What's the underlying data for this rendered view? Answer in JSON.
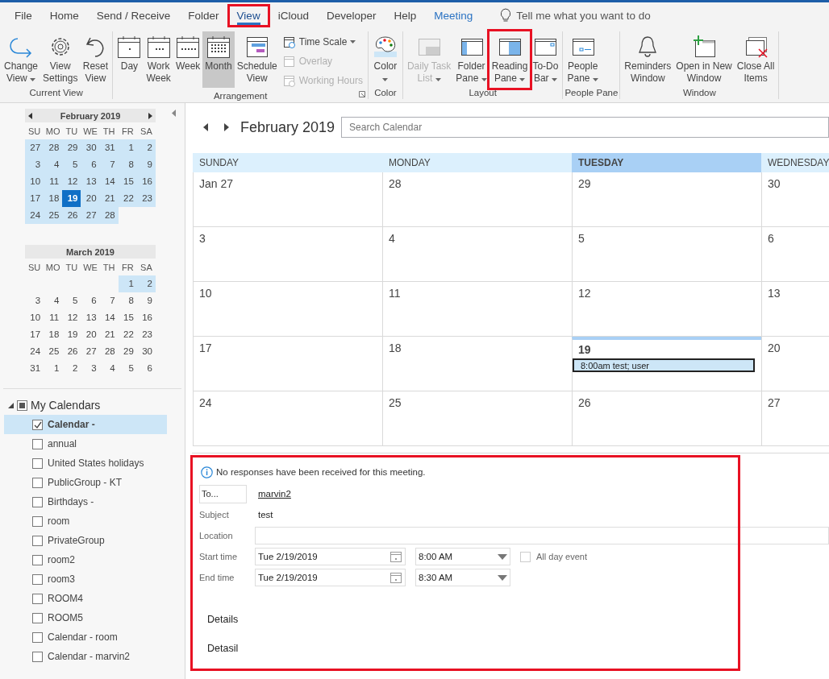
{
  "ribbon_tabs": [
    {
      "label": "File",
      "selected": false,
      "highlighted": false,
      "kind": "normal"
    },
    {
      "label": "Home",
      "selected": false,
      "highlighted": false,
      "kind": "normal"
    },
    {
      "label": "Send / Receive",
      "selected": false,
      "highlighted": false,
      "kind": "normal"
    },
    {
      "label": "Folder",
      "selected": false,
      "highlighted": false,
      "kind": "normal"
    },
    {
      "label": "View",
      "selected": true,
      "highlighted": true,
      "kind": "normal"
    },
    {
      "label": "iCloud",
      "selected": false,
      "highlighted": false,
      "kind": "normal"
    },
    {
      "label": "Developer",
      "selected": false,
      "highlighted": false,
      "kind": "normal"
    },
    {
      "label": "Help",
      "selected": false,
      "highlighted": false,
      "kind": "normal"
    },
    {
      "label": "Meeting",
      "selected": false,
      "highlighted": false,
      "kind": "contextual"
    }
  ],
  "tell_me": {
    "placeholder": "Tell me what you want to do"
  },
  "ribbon_groups": [
    {
      "label": "Current View",
      "buttons": [
        {
          "label": "Change View",
          "dropdown": true,
          "disabled": false,
          "selected": false,
          "highlighted": false
        },
        {
          "label": "View Settings",
          "dropdown": false,
          "disabled": false,
          "selected": false,
          "highlighted": false
        },
        {
          "label": "Reset View",
          "dropdown": false,
          "disabled": false,
          "selected": false,
          "highlighted": false
        }
      ]
    },
    {
      "label": "Arrangement",
      "launcher": true,
      "buttons": [
        {
          "label": "Day",
          "dropdown": false,
          "disabled": false,
          "selected": false,
          "highlighted": false
        },
        {
          "label": "Work Week",
          "dropdown": false,
          "disabled": false,
          "selected": false,
          "highlighted": false
        },
        {
          "label": "Week",
          "dropdown": false,
          "disabled": false,
          "selected": false,
          "highlighted": false
        },
        {
          "label": "Month",
          "dropdown": false,
          "disabled": false,
          "selected": true,
          "highlighted": false
        },
        {
          "label": "Schedule View",
          "dropdown": false,
          "disabled": false,
          "selected": false,
          "highlighted": false
        }
      ],
      "small_buttons": [
        {
          "label": "Time Scale",
          "dropdown": true,
          "disabled": false
        },
        {
          "label": "Overlay",
          "dropdown": false,
          "disabled": true
        },
        {
          "label": "Working Hours",
          "dropdown": false,
          "disabled": true
        }
      ]
    },
    {
      "label": "Color",
      "buttons": [
        {
          "label": "Color",
          "dropdown": true,
          "disabled": false,
          "selected": false,
          "highlighted": false
        }
      ]
    },
    {
      "label": "Layout",
      "buttons": [
        {
          "label": "Daily Task List",
          "dropdown": true,
          "disabled": true,
          "selected": false,
          "highlighted": false
        },
        {
          "label": "Folder Pane",
          "dropdown": true,
          "disabled": false,
          "selected": false,
          "highlighted": false
        },
        {
          "label": "Reading Pane",
          "dropdown": true,
          "disabled": false,
          "selected": false,
          "highlighted": true
        },
        {
          "label": "To-Do Bar",
          "dropdown": true,
          "disabled": false,
          "selected": false,
          "highlighted": false
        }
      ]
    },
    {
      "label": "People Pane",
      "buttons": [
        {
          "label": "People Pane",
          "dropdown": true,
          "disabled": false,
          "selected": false,
          "highlighted": false
        }
      ]
    },
    {
      "label": "Window",
      "buttons": [
        {
          "label": "Reminders Window",
          "dropdown": false,
          "disabled": false,
          "selected": false,
          "highlighted": false
        },
        {
          "label": "Open in New Window",
          "dropdown": false,
          "disabled": false,
          "selected": false,
          "highlighted": false
        },
        {
          "label": "Close All Items",
          "dropdown": false,
          "disabled": false,
          "selected": false,
          "highlighted": false
        }
      ]
    }
  ],
  "mini_calendars": [
    {
      "title": "February 2019",
      "nav": true,
      "weekdays": [
        "SU",
        "MO",
        "TU",
        "WE",
        "TH",
        "FR",
        "SA"
      ],
      "weeks": [
        {
          "in_view": true,
          "days": [
            {
              "day": "27",
              "selected": false
            },
            {
              "day": "28",
              "selected": false
            },
            {
              "day": "29",
              "selected": false
            },
            {
              "day": "30",
              "selected": false
            },
            {
              "day": "31",
              "selected": false
            },
            {
              "day": "1",
              "selected": false
            },
            {
              "day": "2",
              "selected": false
            }
          ]
        },
        {
          "in_view": true,
          "days": [
            {
              "day": "3",
              "selected": false
            },
            {
              "day": "4",
              "selected": false
            },
            {
              "day": "5",
              "selected": false
            },
            {
              "day": "6",
              "selected": false
            },
            {
              "day": "7",
              "selected": false
            },
            {
              "day": "8",
              "selected": false
            },
            {
              "day": "9",
              "selected": false
            }
          ]
        },
        {
          "in_view": true,
          "days": [
            {
              "day": "10",
              "selected": false
            },
            {
              "day": "11",
              "selected": false
            },
            {
              "day": "12",
              "selected": false
            },
            {
              "day": "13",
              "selected": false
            },
            {
              "day": "14",
              "selected": false
            },
            {
              "day": "15",
              "selected": false
            },
            {
              "day": "16",
              "selected": false
            }
          ]
        },
        {
          "in_view": true,
          "days": [
            {
              "day": "17",
              "selected": false
            },
            {
              "day": "18",
              "selected": false
            },
            {
              "day": "19",
              "selected": true
            },
            {
              "day": "20",
              "selected": false
            },
            {
              "day": "21",
              "selected": false
            },
            {
              "day": "22",
              "selected": false
            },
            {
              "day": "23",
              "selected": false
            }
          ]
        },
        {
          "in_view": true,
          "days": [
            {
              "day": "24",
              "selected": false
            },
            {
              "day": "25",
              "selected": false
            },
            {
              "day": "26",
              "selected": false
            },
            {
              "day": "27",
              "selected": false
            },
            {
              "day": "28",
              "selected": false
            }
          ]
        }
      ]
    },
    {
      "title": "March 2019",
      "nav": false,
      "weekdays": [
        "SU",
        "MO",
        "TU",
        "WE",
        "TH",
        "FR",
        "SA"
      ],
      "weeks": [
        {
          "in_view": true,
          "days": [
            {
              "day": "1",
              "selected": false
            },
            {
              "day": "2",
              "selected": false
            }
          ]
        },
        {
          "in_view": false,
          "days": [
            {
              "day": "3",
              "selected": false
            },
            {
              "day": "4",
              "selected": false
            },
            {
              "day": "5",
              "selected": false
            },
            {
              "day": "6",
              "selected": false
            },
            {
              "day": "7",
              "selected": false
            },
            {
              "day": "8",
              "selected": false
            },
            {
              "day": "9",
              "selected": false
            }
          ]
        },
        {
          "in_view": false,
          "days": [
            {
              "day": "10",
              "selected": false
            },
            {
              "day": "11",
              "selected": false
            },
            {
              "day": "12",
              "selected": false
            },
            {
              "day": "13",
              "selected": false
            },
            {
              "day": "14",
              "selected": false
            },
            {
              "day": "15",
              "selected": false
            },
            {
              "day": "16",
              "selected": false
            }
          ]
        },
        {
          "in_view": false,
          "days": [
            {
              "day": "17",
              "selected": false
            },
            {
              "day": "18",
              "selected": false
            },
            {
              "day": "19",
              "selected": false
            },
            {
              "day": "20",
              "selected": false
            },
            {
              "day": "21",
              "selected": false
            },
            {
              "day": "22",
              "selected": false
            },
            {
              "day": "23",
              "selected": false
            }
          ]
        },
        {
          "in_view": false,
          "days": [
            {
              "day": "24",
              "selected": false
            },
            {
              "day": "25",
              "selected": false
            },
            {
              "day": "26",
              "selected": false
            },
            {
              "day": "27",
              "selected": false
            },
            {
              "day": "28",
              "selected": false
            },
            {
              "day": "29",
              "selected": false
            },
            {
              "day": "30",
              "selected": false
            }
          ]
        },
        {
          "in_view": false,
          "days": [
            {
              "day": "31",
              "selected": false
            },
            {
              "day": "1",
              "selected": false
            },
            {
              "day": "2",
              "selected": false
            },
            {
              "day": "3",
              "selected": false
            },
            {
              "day": "4",
              "selected": false
            },
            {
              "day": "5",
              "selected": false
            },
            {
              "day": "6",
              "selected": false
            }
          ]
        }
      ]
    }
  ],
  "calendar_groups": [
    {
      "label": "My Calendars",
      "expanded": true,
      "checked": true,
      "items": [
        {
          "label": "Calendar -",
          "checked": true,
          "selected": true
        },
        {
          "label": "annual",
          "checked": false,
          "selected": false
        },
        {
          "label": "United States holidays",
          "checked": false,
          "selected": false
        },
        {
          "label": "PublicGroup - KT",
          "checked": false,
          "selected": false
        },
        {
          "label": "Birthdays -",
          "checked": false,
          "selected": false
        },
        {
          "label": "room",
          "checked": false,
          "selected": false
        },
        {
          "label": "PrivateGroup",
          "checked": false,
          "selected": false
        },
        {
          "label": "room2",
          "checked": false,
          "selected": false
        },
        {
          "label": "room3",
          "checked": false,
          "selected": false
        },
        {
          "label": "ROOM4",
          "checked": false,
          "selected": false
        },
        {
          "label": "ROOM5",
          "checked": false,
          "selected": false
        },
        {
          "label": "Calendar - room",
          "checked": false,
          "selected": false
        },
        {
          "label": "Calendar - marvin2",
          "checked": false,
          "selected": false
        }
      ]
    }
  ],
  "month_view": {
    "title": "February 2019",
    "search": {
      "placeholder": "Search Calendar"
    },
    "columns": [
      {
        "label": "SUNDAY",
        "today": false
      },
      {
        "label": "MONDAY",
        "today": false
      },
      {
        "label": "TUESDAY",
        "today": true
      },
      {
        "label": "WEDNESDAY",
        "today": false
      }
    ],
    "weeks": [
      [
        {
          "date": "Jan 27",
          "today": false
        },
        {
          "date": "28",
          "today": false
        },
        {
          "date": "29",
          "today": false
        },
        {
          "date": "30",
          "today": false
        }
      ],
      [
        {
          "date": "3",
          "today": false
        },
        {
          "date": "4",
          "today": false
        },
        {
          "date": "5",
          "today": false
        },
        {
          "date": "6",
          "today": false
        }
      ],
      [
        {
          "date": "10",
          "today": false
        },
        {
          "date": "11",
          "today": false
        },
        {
          "date": "12",
          "today": false
        },
        {
          "date": "13",
          "today": false
        }
      ],
      [
        {
          "date": "17",
          "today": false
        },
        {
          "date": "18",
          "today": false
        },
        {
          "date": "19",
          "today": true,
          "events": [
            {
              "title": "8:00am test; user",
              "selected": true
            }
          ]
        },
        {
          "date": "20",
          "today": false
        }
      ],
      [
        {
          "date": "24",
          "today": false
        },
        {
          "date": "25",
          "today": false
        },
        {
          "date": "26",
          "today": false
        },
        {
          "date": "27",
          "today": false
        }
      ]
    ]
  },
  "reading_pane": {
    "highlighted": true,
    "info": "No responses have been received for this meeting.",
    "to": {
      "button": "To...",
      "value": "marvin2"
    },
    "subject": {
      "label": "Subject",
      "value": "test"
    },
    "location": {
      "label": "Location"
    },
    "start": {
      "label": "Start time",
      "date": "Tue 2/19/2019",
      "time": "8:00 AM"
    },
    "end": {
      "label": "End time",
      "date": "Tue 2/19/2019",
      "time": "8:30 AM"
    },
    "all_day": {
      "label": "All day event",
      "checked": false
    },
    "body": [
      "Details",
      "Detasil"
    ]
  }
}
